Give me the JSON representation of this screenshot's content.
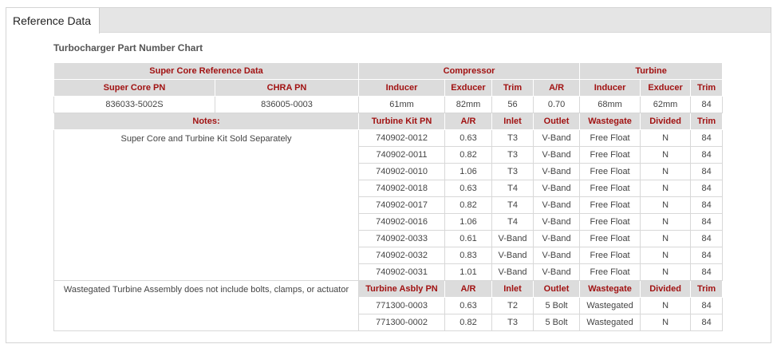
{
  "tabs": [
    {
      "label": "Reference Data"
    }
  ],
  "chart_title": "Turbocharger Part Number Chart",
  "groups": {
    "super_core": "Super Core Reference Data",
    "compressor": "Compressor",
    "turbine": "Turbine"
  },
  "part_headers": {
    "super_core_pn": "Super Core PN",
    "chra_pn": "CHRA PN",
    "inducer": "Inducer",
    "exducer": "Exducer",
    "trim": "Trim",
    "ar": "A/R",
    "turbine_inducer": "Inducer",
    "turbine_exducer": "Exducer",
    "turbine_trim": "Trim"
  },
  "part_values": {
    "super_core_pn": "836033-5002S",
    "chra_pn": "836005-0003",
    "inducer": "61mm",
    "exducer": "82mm",
    "trim": "56",
    "ar": "0.70",
    "turbine_inducer": "68mm",
    "turbine_exducer": "62mm",
    "turbine_trim": "84"
  },
  "kit_section": {
    "notes_label": "Notes:",
    "headers": [
      "Turbine Kit PN",
      "A/R",
      "Inlet",
      "Outlet",
      "Wastegate",
      "Divided",
      "Trim"
    ],
    "note": "Super Core and Turbine Kit Sold Separately",
    "rows": [
      [
        "740902-0012",
        "0.63",
        "T3",
        "V-Band",
        "Free Float",
        "N",
        "84"
      ],
      [
        "740902-0011",
        "0.82",
        "T3",
        "V-Band",
        "Free Float",
        "N",
        "84"
      ],
      [
        "740902-0010",
        "1.06",
        "T3",
        "V-Band",
        "Free Float",
        "N",
        "84"
      ],
      [
        "740902-0018",
        "0.63",
        "T4",
        "V-Band",
        "Free Float",
        "N",
        "84"
      ],
      [
        "740902-0017",
        "0.82",
        "T4",
        "V-Band",
        "Free Float",
        "N",
        "84"
      ],
      [
        "740902-0016",
        "1.06",
        "T4",
        "V-Band",
        "Free Float",
        "N",
        "84"
      ],
      [
        "740902-0033",
        "0.61",
        "V-Band",
        "V-Band",
        "Free Float",
        "N",
        "84"
      ],
      [
        "740902-0032",
        "0.83",
        "V-Band",
        "V-Band",
        "Free Float",
        "N",
        "84"
      ],
      [
        "740902-0031",
        "1.01",
        "V-Band",
        "V-Band",
        "Free Float",
        "N",
        "84"
      ]
    ]
  },
  "assembly_section": {
    "note": "Wastegated Turbine Assembly does not include bolts, clamps, or actuator",
    "headers": [
      "Turbine Asbly PN",
      "A/R",
      "Inlet",
      "Outlet",
      "Wastegate",
      "Divided",
      "Trim"
    ],
    "rows": [
      [
        "771300-0003",
        "0.63",
        "T2",
        "5 Bolt",
        "Wastegated",
        "N",
        "84"
      ],
      [
        "771300-0002",
        "0.82",
        "T3",
        "5 Bolt",
        "Wastegated",
        "N",
        "84"
      ]
    ]
  },
  "colors": {
    "header_bg": "#dcdcdc",
    "header_text": "#a11212",
    "tab_bar_bg": "#e5e5e5"
  }
}
